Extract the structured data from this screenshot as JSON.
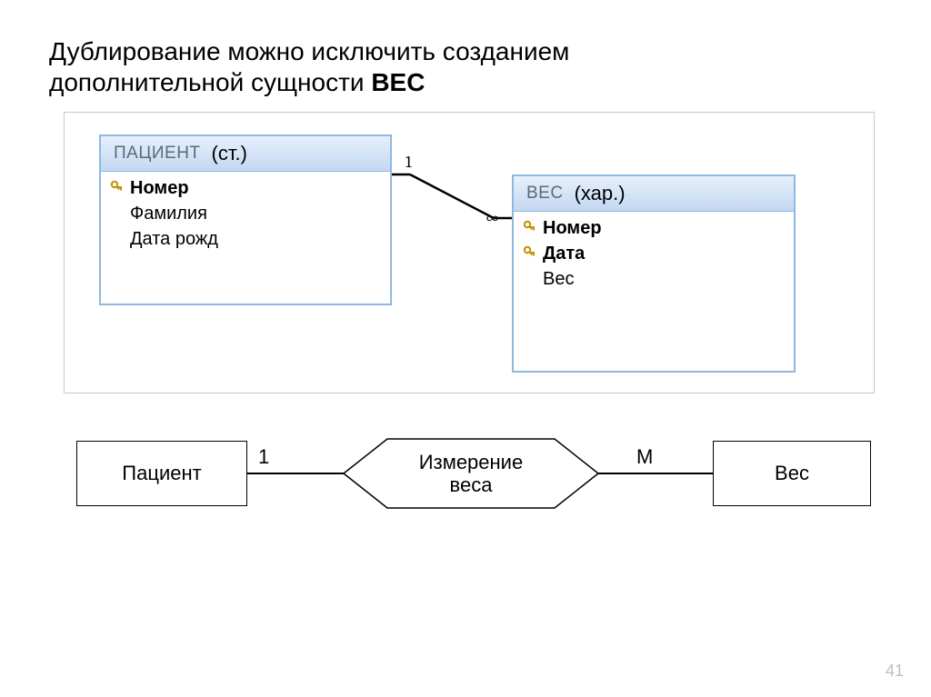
{
  "title": {
    "line1": "Дублирование можно исключить созданием",
    "line2_prefix": "дополнительной сущности ",
    "line2_bold": "ВЕС"
  },
  "tables": {
    "patient": {
      "name": "ПАЦИЕНТ",
      "annotation": "(ст.)",
      "fields": [
        {
          "label": "Номер",
          "isKey": true,
          "bold": true
        },
        {
          "label": "Фамилия",
          "isKey": false,
          "bold": false
        },
        {
          "label": "Дата рожд",
          "isKey": false,
          "bold": false
        }
      ]
    },
    "weight": {
      "name": "BEC",
      "annotation": "(хар.)",
      "fields": [
        {
          "label": "Номер",
          "isKey": true,
          "bold": true
        },
        {
          "label": "Дата",
          "isKey": true,
          "bold": true
        },
        {
          "label": "Вес",
          "isKey": false,
          "bold": false
        }
      ]
    }
  },
  "db_relation": {
    "card_one": "1",
    "card_many": "∞"
  },
  "er": {
    "patient": "Пациент",
    "relationship": "Измерение\nвеса",
    "weight": "Вес",
    "card_left": "1",
    "card_right": "М"
  },
  "page_number": "41"
}
